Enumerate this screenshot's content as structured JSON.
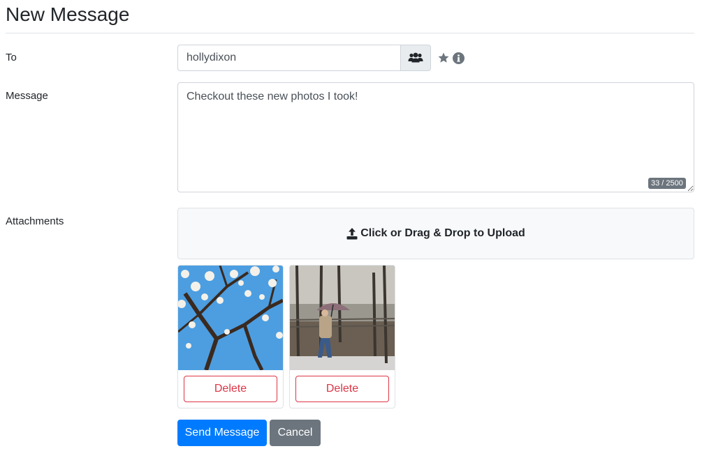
{
  "page": {
    "title": "New Message"
  },
  "form": {
    "to_label": "To",
    "to_value": "hollydixon",
    "message_label": "Message",
    "message_value": "Checkout these new photos I took!",
    "char_count": "33 / 2500",
    "attachments_label": "Attachments"
  },
  "icons": {
    "contacts": "users-icon",
    "favorite": "star-icon",
    "info": "info-icon",
    "upload": "upload-icon"
  },
  "upload": {
    "label": "Click or Drag & Drop to Upload"
  },
  "attachments": [
    {
      "delete_label": "Delete"
    },
    {
      "delete_label": "Delete"
    }
  ],
  "actions": {
    "send_label": "Send Message",
    "cancel_label": "Cancel"
  },
  "colors": {
    "primary": "#007bff",
    "secondary": "#6c757d",
    "danger": "#dc3545",
    "border": "#ced4da"
  }
}
